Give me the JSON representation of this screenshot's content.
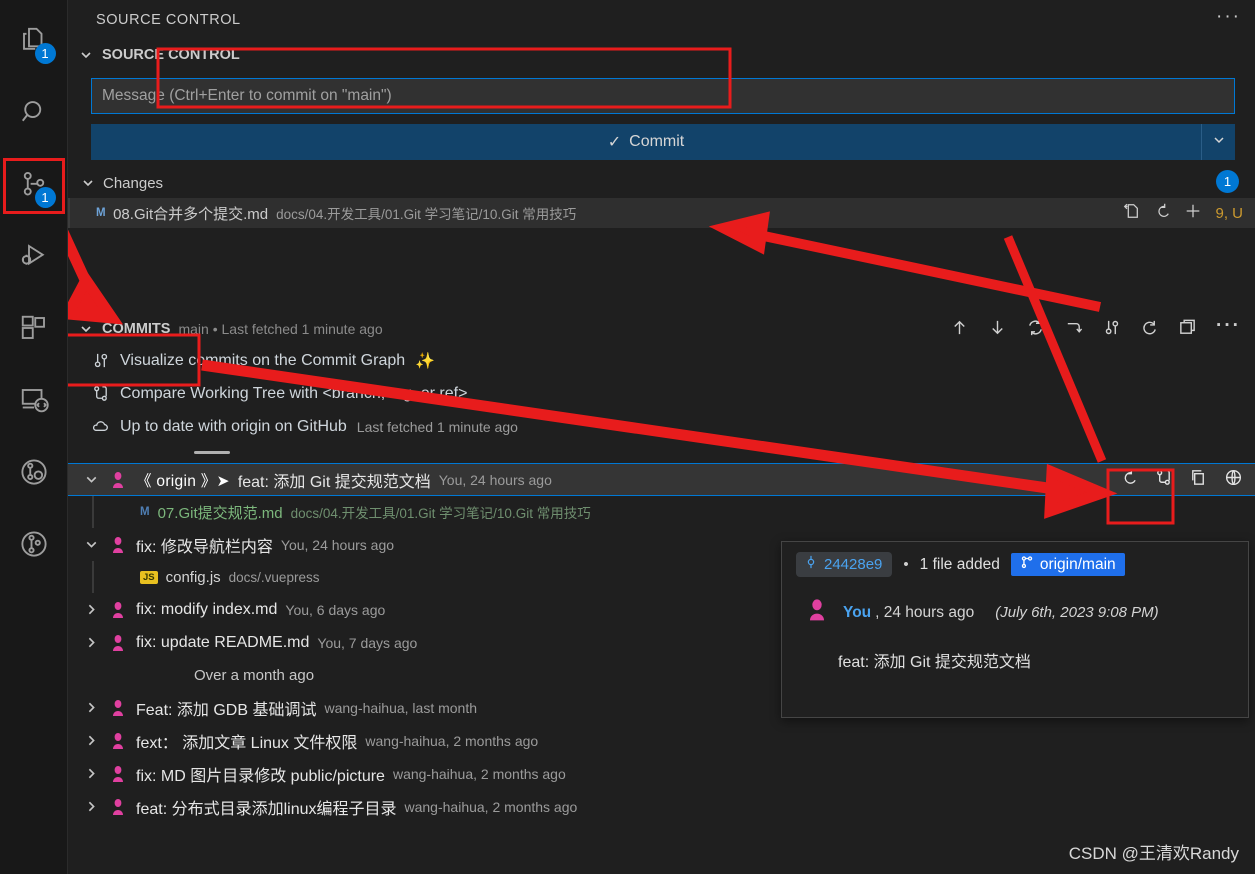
{
  "activitybar": {
    "items": [
      {
        "name": "explorer",
        "icon": "files-icon",
        "badge": "1",
        "selected": false
      },
      {
        "name": "search",
        "icon": "search-icon",
        "badge": "",
        "selected": false
      },
      {
        "name": "source-control",
        "icon": "source-control-icon",
        "badge": "1",
        "selected": true
      },
      {
        "name": "run-and-debug",
        "icon": "run-debug-icon",
        "badge": "",
        "selected": false
      },
      {
        "name": "extensions",
        "icon": "extensions-icon",
        "badge": "",
        "selected": false
      },
      {
        "name": "remote-explorer",
        "icon": "remote-explorer-icon",
        "badge": "",
        "selected": false
      },
      {
        "name": "gitlens-inspect",
        "icon": "gitlens-inspect-icon",
        "badge": "",
        "selected": false
      },
      {
        "name": "gitlens",
        "icon": "gitlens-icon",
        "badge": "",
        "selected": false
      }
    ]
  },
  "panel": {
    "title": "SOURCE CONTROL",
    "more_actions": "···",
    "section_title": "SOURCE CONTROL"
  },
  "message_input": {
    "placeholder": "Message (Ctrl+Enter to commit on \"main\")",
    "value": ""
  },
  "commit_button": {
    "label": "Commit",
    "check": "✓",
    "dropdown_icon": "chevron-down-icon"
  },
  "changes": {
    "label": "Changes",
    "count": "1",
    "files": [
      {
        "status": "M",
        "name": "08.Git合并多个提交.md",
        "path": "docs/04.开发工具/01.Git 学习笔记/10.Git 常用技巧",
        "actions": [
          "open-file-icon",
          "discard-changes-icon",
          "stage-changes-icon"
        ],
        "stat": "9, U"
      }
    ]
  },
  "commits_section": {
    "label": "COMMITS",
    "branch_info": "main • Last fetched 1 minute ago",
    "toolbar": [
      "push-icon",
      "pull-icon",
      "sync-icon",
      "switch-icon",
      "commit-graph-icon",
      "refresh-icon",
      "split-editor-icon",
      "more-icon"
    ],
    "actions": [
      {
        "icon": "commit-graph-icon",
        "label": "Visualize commits on the Commit Graph",
        "suffix": "✨",
        "meta": ""
      },
      {
        "icon": "compare-icon",
        "label": "Compare Working Tree with <branch, tag, or ref>",
        "suffix": "",
        "meta": ""
      },
      {
        "icon": "cloud-icon",
        "label": "Up to date with origin on GitHub",
        "suffix": "",
        "meta": "Last fetched 1 minute ago"
      }
    ]
  },
  "commits": [
    {
      "expanded": true,
      "selected": true,
      "origin_badge": "《 origin 》➤",
      "message": "feat: 添加 Git 提交规范文档",
      "meta": "You, 24 hours ago",
      "actions": [
        "revert-icon",
        "compare-icon",
        "copy-icon",
        "open-on-remote-icon"
      ],
      "files": [
        {
          "status": "M",
          "kind": "md",
          "name": "07.Git提交规范.md",
          "path": "docs/04.开发工具/01.Git 学习笔记/10.Git 常用技巧"
        }
      ]
    },
    {
      "expanded": true,
      "selected": false,
      "origin_badge": "",
      "message": "fix: 修改导航栏内容",
      "meta": "You, 24 hours ago",
      "actions": [],
      "files": [
        {
          "status": "JS",
          "kind": "js",
          "name": "config.js",
          "path": "docs/.vuepress"
        }
      ]
    },
    {
      "expanded": false,
      "selected": false,
      "origin_badge": "",
      "message": "fix: modify index.md",
      "meta": "You, 6 days ago",
      "actions": [],
      "files": []
    },
    {
      "expanded": false,
      "selected": false,
      "origin_badge": "",
      "message": "fix: update README.md",
      "meta": "You, 7 days ago",
      "actions": [],
      "files": []
    }
  ],
  "separator": "Over a month ago",
  "older_commits": [
    {
      "message": "Feat: 添加 GDB 基础调试",
      "meta": "wang-haihua, last month"
    },
    {
      "message": "fext： 添加文章 Linux 文件权限",
      "meta": "wang-haihua, 2 months ago"
    },
    {
      "message": "fix: MD 图片目录修改 public/picture",
      "meta": "wang-haihua, 2 months ago"
    },
    {
      "message": "feat: 分布式目录添加linux编程子目录",
      "meta": "wang-haihua, 2 months ago"
    }
  ],
  "tooltip": {
    "sha": "24428e9",
    "sha_icon": "commit-icon",
    "dot": "•",
    "files_changed": "1 file added",
    "branch": "origin/main",
    "branch_icon": "branch-icon",
    "author_icon": "avatar-icon",
    "author": "You",
    "relative_time": ", 24 hours ago",
    "absolute_time": "(July 6th, 2023 9:08 PM)",
    "message": "feat: 添加 Git 提交规范文档"
  },
  "watermark": "CSDN @王清欢Randy",
  "colors": {
    "accent": "#0078d4",
    "annotation": "#e81c1c",
    "commit_button": "#12436a",
    "added_file": "#7cb77c",
    "modified_file": "#6ea3d8",
    "stat_warning": "#cc9a2f",
    "branch_chip": "#1f6feb"
  }
}
